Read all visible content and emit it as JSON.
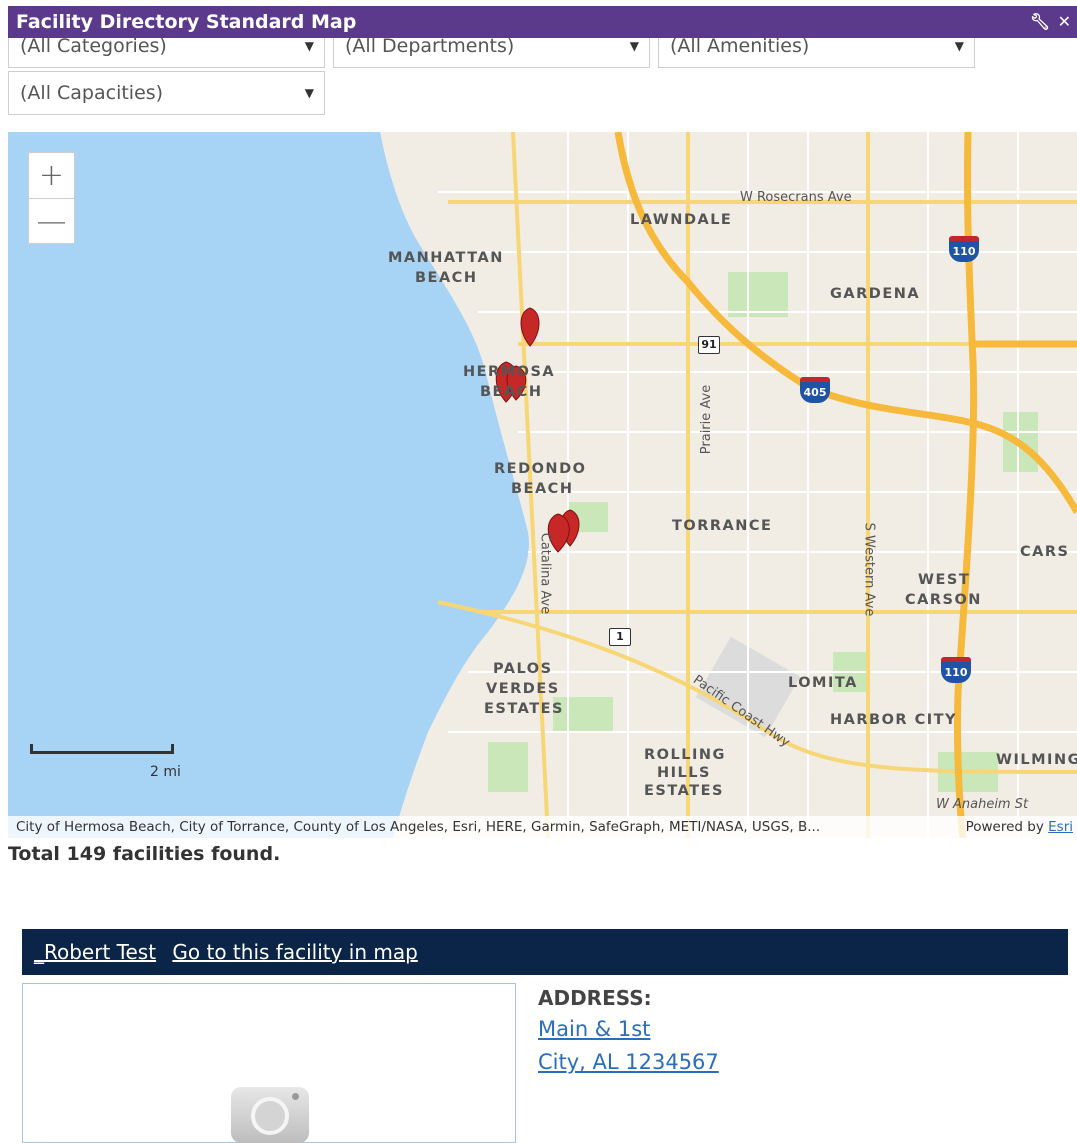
{
  "widget": {
    "title": "Facility Directory Standard Map",
    "tools": [
      "wrench-icon",
      "close-icon"
    ]
  },
  "filters": {
    "categories": "(All Categories)",
    "departments": "(All Departments)",
    "amenities": "(All Amenities)",
    "capacities": "(All Capacities)"
  },
  "map": {
    "zoom_in": "+",
    "zoom_out": "—",
    "scale": "2 mi",
    "attribution": "City of Hermosa Beach, City of Torrance, County of Los Angeles, Esri, HERE, Garmin, SafeGraph, METI/NASA, USGS, B...",
    "powered_by": "Powered by",
    "powered_link": "Esri",
    "places": {
      "lawndale": "LAWNDALE",
      "manhattan": "MANHATTAN",
      "beach1": "BEACH",
      "gardena": "GARDENA",
      "hermosa": "HERMOSA",
      "beach2": "BEACH",
      "redondo": "REDONDO",
      "beach3": "BEACH",
      "torrance": "TORRANCE",
      "carson": "CARS",
      "west": "WEST",
      "carson2": "CARSON",
      "palos": "PALOS",
      "verdes": "VERDES",
      "estates": "ESTATES",
      "lomita": "LOMITA",
      "harbor_city": "HARBOR CITY",
      "rolling": "ROLLING",
      "hills": "HILLS",
      "estates2": "ESTATES",
      "wilming": "WILMING"
    },
    "roads": {
      "rosecrans": "W Rosecrans Ave",
      "prairie": "Prairie Ave",
      "western": "S Western Ave",
      "catalina": "Catalina Ave",
      "pch": "Pacific Coast Hwy",
      "anaheim": "W Anaheim St"
    },
    "shields": {
      "i110_top": "110",
      "i405": "405",
      "i110_bottom": "110",
      "r91": "91",
      "r1": "1"
    }
  },
  "results": {
    "total": "Total 149 facilities found."
  },
  "facility": {
    "name_link": "_Robert Test",
    "map_link": "Go to this facility in map",
    "address_label": "ADDRESS:",
    "address_line1": "Main & 1st",
    "address_line2": "City, AL 1234567"
  },
  "colors": {
    "titlebar": "#5b3a8c",
    "facility_header": "#0a2548",
    "link": "#2a6ebb",
    "water": "#a7d3f5",
    "land": "#f2ede4",
    "marker": "#c62828"
  }
}
